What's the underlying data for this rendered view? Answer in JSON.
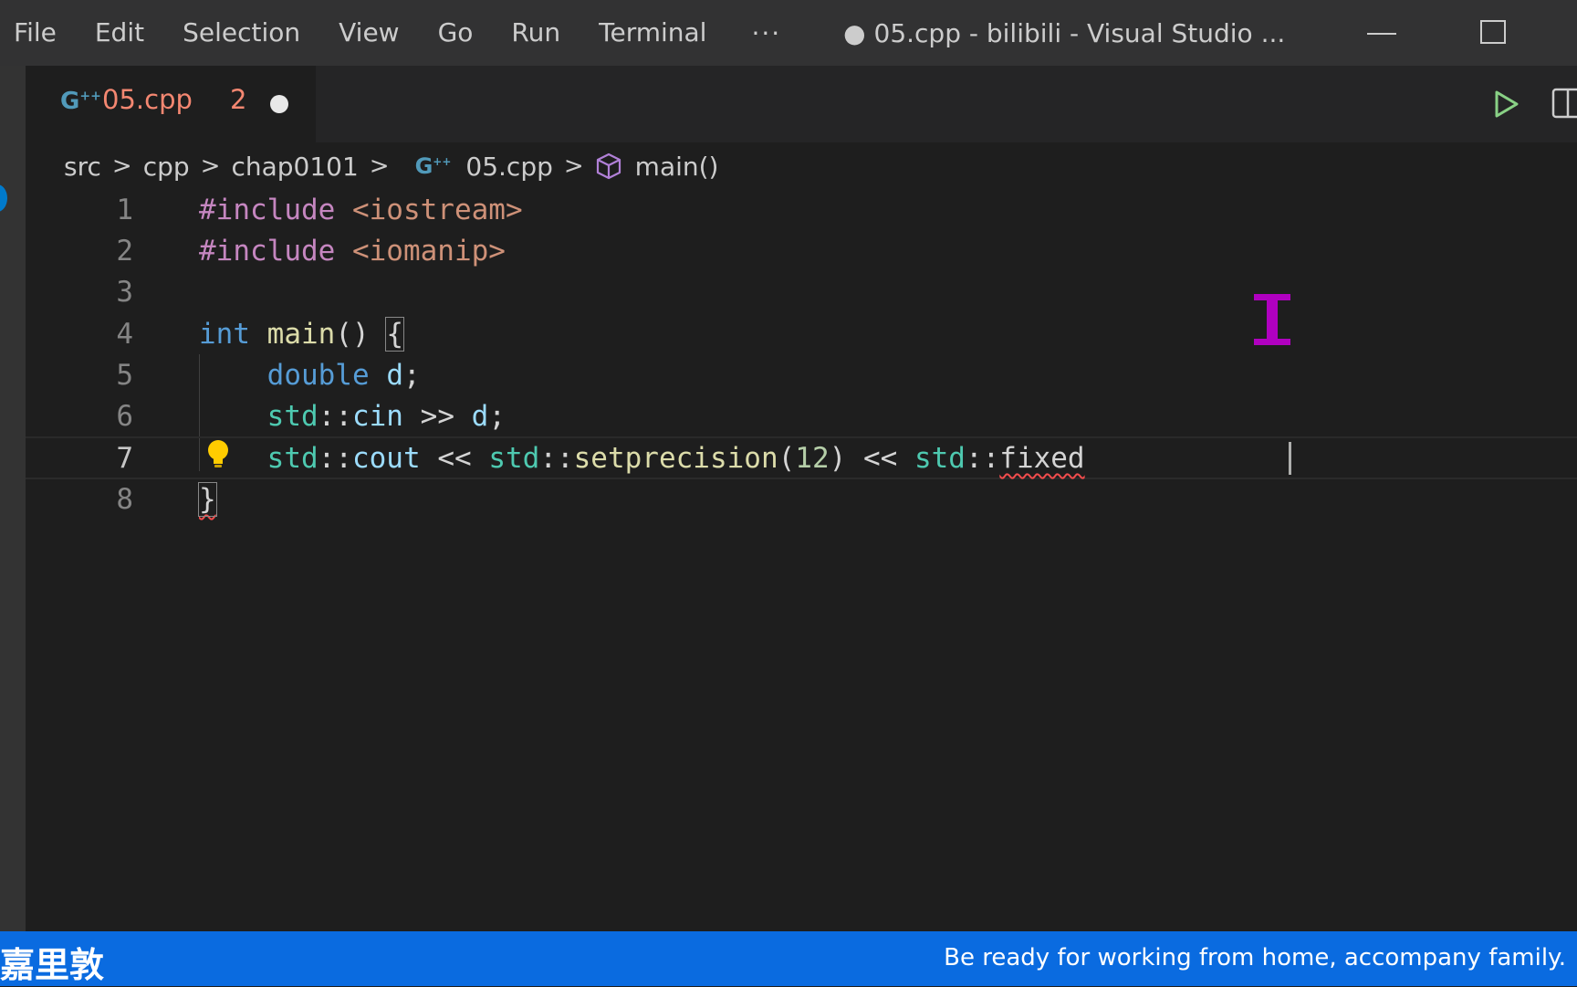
{
  "menu": {
    "items": [
      "File",
      "Edit",
      "Selection",
      "View",
      "Go",
      "Run",
      "Terminal"
    ],
    "more": "···"
  },
  "window": {
    "title": "● 05.cpp - bilibili - Visual Studio ..."
  },
  "tab": {
    "icon": "cpp-file-icon",
    "label": "05.cpp",
    "problems": "2"
  },
  "breadcrumb": {
    "parts": [
      "src",
      "cpp",
      "chap0101"
    ],
    "file": "05.cpp",
    "symbol": "main()"
  },
  "editor": {
    "lines": [
      {
        "n": "1"
      },
      {
        "n": "2"
      },
      {
        "n": "3"
      },
      {
        "n": "4"
      },
      {
        "n": "5"
      },
      {
        "n": "6"
      },
      {
        "n": "7"
      },
      {
        "n": "8"
      }
    ],
    "tokens": {
      "l1_pp": "#include",
      "l1_hdr": "<iostream>",
      "l2_pp": "#include",
      "l2_hdr": "<iomanip>",
      "l4_kw": "int",
      "l4_fn": "main",
      "l4_paren": "()",
      "l4_brace": "{",
      "l5_kw": "double",
      "l5_var": "d",
      "l5_semi": ";",
      "l6_ns": "std",
      "l6_colon": "::",
      "l6_var": "cin",
      "l6_op": ">>",
      "l6_var2": "d",
      "l6_semi": ";",
      "l7_ns1": "std",
      "l7_colon1": "::",
      "l7_var": "cout",
      "l7_op1": "<<",
      "l7_ns2": "std",
      "l7_colon2": "::",
      "l7_fn": "setprecision",
      "l7_lparen": "(",
      "l7_num": "12",
      "l7_rparen": ")",
      "l7_op2": "<<",
      "l7_ns3": "std",
      "l7_colon3": "::",
      "l7_fixed": "fixed",
      "l8_brace": "}"
    }
  },
  "banner": {
    "left": "嘉里敦",
    "right": "Be ready for working from home, accompany family."
  },
  "colors": {
    "accent": "#007acc",
    "banner": "#0a6be0",
    "error": "#f48771"
  }
}
